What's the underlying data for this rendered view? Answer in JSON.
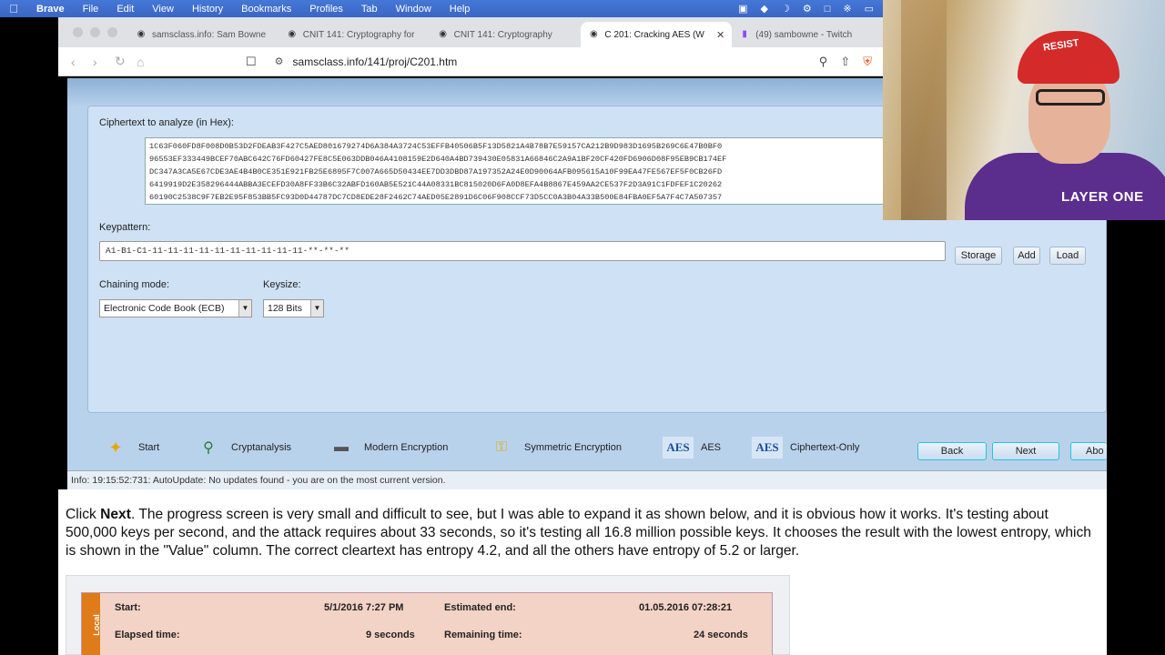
{
  "menubar": {
    "items": [
      "Brave",
      "File",
      "Edit",
      "View",
      "History",
      "Bookmarks",
      "Profiles",
      "Tab",
      "Window",
      "Help"
    ]
  },
  "tabs": [
    {
      "title": "samsclass.info: Sam Bowne",
      "active": false
    },
    {
      "title": "CNIT 141: Cryptography for",
      "active": false
    },
    {
      "title": "CNIT 141: Cryptography",
      "active": false
    },
    {
      "title": "C 201: Cracking AES (W",
      "active": true
    },
    {
      "title": "(49) sambowne - Twitch",
      "active": false
    }
  ],
  "address": {
    "url": "samsclass.info/141/proj/C201.htm"
  },
  "cryptool": {
    "ciphertext_label": "Ciphertext to analyze (in Hex):",
    "hex_lines": [
      "1C63F060FD8F008D0B53D2FDEAB3F427C5AED801679274D6A384A3724C53EFFB40506B5F13D5821A4B78B7E59157CA212B9D983D1695B269C6E47B0BF0",
      "96553EF333449BCEF70ABC642C76FD60427FE8C5E063DDB046A4108159E2D640A4BD739430E05831A66846C2A9A1BF20CF420FD6906D08F95EB9CB174EF",
      "DC347A3CA5E67CDE3AE4B4B0CE351E921FB25E6895F7C007A665D50434EE7DD3DBD87A197352A24E0D90064AFB095615A10F99EA47FE567EF5F0CB26FD",
      "6419919D2E358296444ABBA3ECEFD30A8FF33B6C32ABFD160AB5E521C44A08331BC815020D6FA0D8EFA4B8867E459AA2CE537F2D3A91C1FDFEF1C20262",
      "60190C2538C9F7EB2E95F853BB5FC93D0D44787DC7CD8EDE28F2462C74AED05E2891D6C06F908CCF73D5CC0A3B04A33B500E84FBA0EF5A7F4C7A507357"
    ],
    "keypattern_label": "Keypattern:",
    "keypattern_value": "A1-B1-C1-11-11-11-11-11-11-11-11-11-11-**-**-**",
    "storage_btn": "Storage",
    "add_btn": "Add",
    "load_btn": "Load",
    "chaining_label": "Chaining mode:",
    "chaining_value": "Electronic Code Book (ECB)",
    "keysize_label": "Keysize:",
    "keysize_value": "128 Bits",
    "wizard": {
      "start": "Start",
      "cryptanalysis": "Cryptanalysis",
      "modern": "Modern Encryption",
      "symmetric": "Symmetric Encryption",
      "aes_icon": "AES",
      "aes": "AES",
      "ciphertext_only": "Ciphertext-Only"
    },
    "back_btn": "Back",
    "next_btn": "Next",
    "about_btn": "Abo",
    "info": "Info: 19:15:52:731: AutoUpdate: No updates found - you are on the most current version."
  },
  "webcam": {
    "hat_text": "RESIST",
    "shirt_text": "LAYER ONE"
  },
  "article": {
    "p1": "Click ",
    "p_bold": "Next",
    "p2": ". The progress screen is very small and difficult to see, but I was able to expand it as shown below, and it is obvious how it works. It's testing about 500,000 keys per second, and the attack requires about 33 seconds, so it's testing all 16.8 million possible keys. It chooses the result with the lowest entropy, which is shown in the \"Value\" column. The correct cleartext has entropy 4.2, and all the others have entropy of 5.2 or larger.",
    "progress": {
      "side_tab": "Local",
      "start_label": "Start:",
      "start_value": "5/1/2016 7:27 PM",
      "est_end_label": "Estimated end:",
      "est_end_value": "01.05.2016 07:28:21",
      "elapsed_label": "Elapsed time:",
      "elapsed_value": "9 seconds",
      "remaining_label": "Remaining time:",
      "remaining_value": "24 seconds"
    }
  }
}
